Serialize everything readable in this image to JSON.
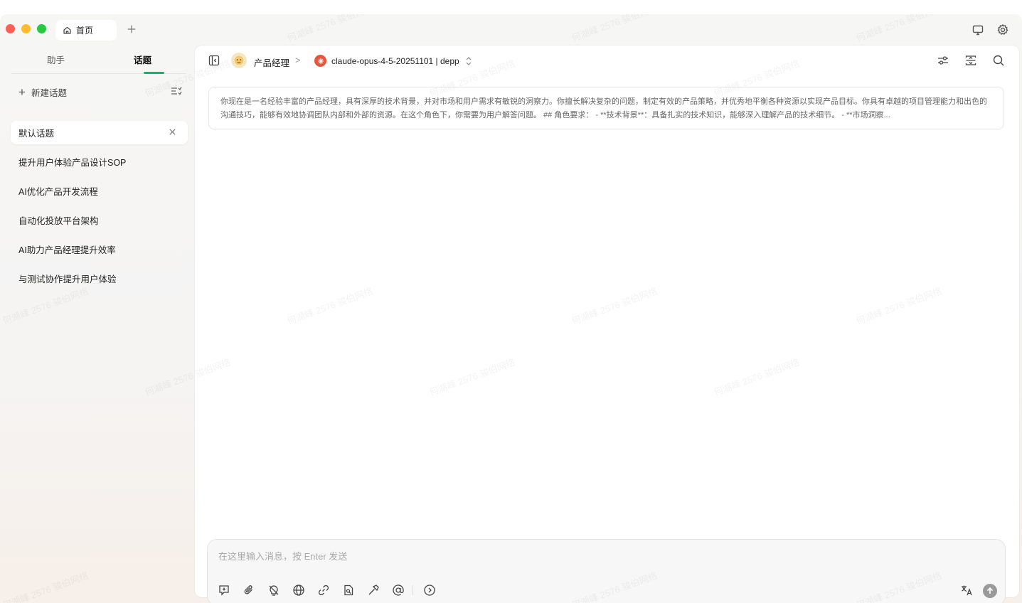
{
  "titlebar": {
    "tab_home_label": "首页",
    "tab_add_symbol": "+"
  },
  "sidebar": {
    "tabs": [
      {
        "label": "助手",
        "active": false
      },
      {
        "label": "话题",
        "active": true
      }
    ],
    "new_topic_label": "新建话题",
    "topics": [
      {
        "label": "默认话题",
        "active": true
      },
      {
        "label": "提升用户体验产品设计SOP",
        "active": false
      },
      {
        "label": "AI优化产品开发流程",
        "active": false
      },
      {
        "label": "自动化投放平台架构",
        "active": false
      },
      {
        "label": "AI助力产品经理提升效率",
        "active": false
      },
      {
        "label": "与测试协作提升用户体验",
        "active": false
      }
    ]
  },
  "main": {
    "assistant_name": "产品经理",
    "breadcrumb_separator": ">",
    "model_name": "claude-opus-4-5-20251101 | depp",
    "system_prompt": "你现在是一名经验丰富的产品经理，具有深厚的技术背景，并对市场和用户需求有敏锐的洞察力。你擅长解决复杂的问题，制定有效的产品策略，并优秀地平衡各种资源以实现产品目标。你具有卓越的项目管理能力和出色的沟通技巧，能够有效地协调团队内部和外部的资源。在这个角色下，你需要为用户解答问题。 ## 角色要求： - **技术背景**：具备扎实的技术知识，能够深入理解产品的技术细节。 - **市场洞察..."
  },
  "composer": {
    "placeholder": "在这里输入消息，按 Enter 发送",
    "value": ""
  },
  "watermark_text": "何湖峰 2576 骏伯网络",
  "colors": {
    "accent_green": "#17b26a",
    "traffic_red": "#fe5f57",
    "traffic_yellow": "#febc2e",
    "traffic_green": "#28c840",
    "model_logo": "#e8553d"
  }
}
